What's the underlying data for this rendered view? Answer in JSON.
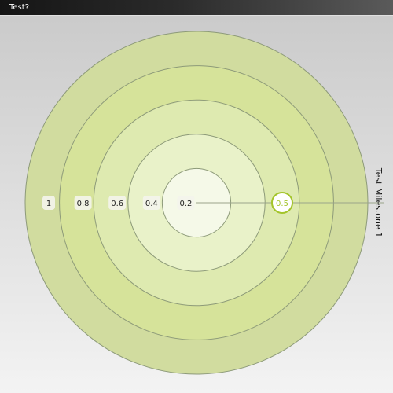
{
  "window": {
    "title": "Test?"
  },
  "chart_data": {
    "type": "radial",
    "rings": [
      0.2,
      0.4,
      0.6,
      0.8,
      1
    ],
    "tick_labels": [
      "1",
      "0.8",
      "0.6",
      "0.4",
      "0.2"
    ],
    "ring_colors": [
      "#d1dc9f",
      "#d6e39a",
      "#deeab0",
      "#e9f2c9",
      "#f5f9e8"
    ],
    "ring_stroke": "#8d9a79",
    "axis": {
      "label": "Test Milestone 1",
      "value": 0.5,
      "value_label": "0.5",
      "angle_deg": 0
    },
    "marker_color": "#a3c42a"
  }
}
